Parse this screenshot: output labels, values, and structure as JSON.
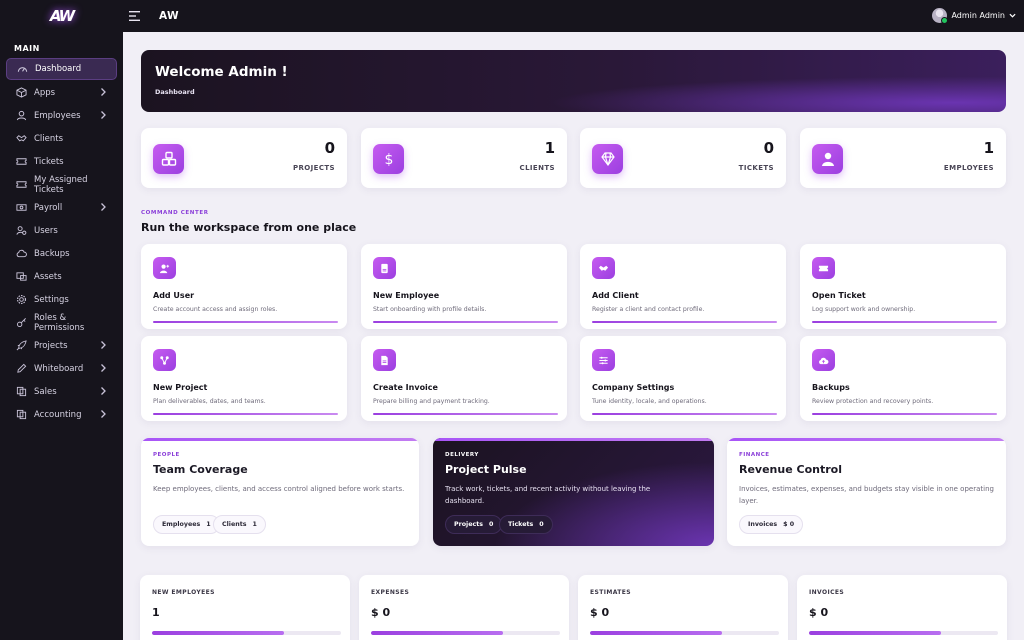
{
  "brand": {
    "logo_text": "AW",
    "title": "AW"
  },
  "user": {
    "name": "Admin Admin"
  },
  "sidebar": {
    "section": "MAIN",
    "items": [
      {
        "label": "Dashboard",
        "icon": "dashboard-icon",
        "active": true,
        "expandable": false
      },
      {
        "label": "Apps",
        "icon": "cube-icon",
        "expandable": true
      },
      {
        "label": "Employees",
        "icon": "user-icon",
        "expandable": true
      },
      {
        "label": "Clients",
        "icon": "handshake-icon",
        "expandable": false
      },
      {
        "label": "Tickets",
        "icon": "ticket-icon",
        "expandable": false
      },
      {
        "label": "My Assigned Tickets",
        "icon": "ticket-icon",
        "expandable": false
      },
      {
        "label": "Payroll",
        "icon": "money-icon",
        "expandable": true
      },
      {
        "label": "Users",
        "icon": "users-gear-icon",
        "expandable": false
      },
      {
        "label": "Backups",
        "icon": "cloud-icon",
        "expandable": false
      },
      {
        "label": "Assets",
        "icon": "assets-icon",
        "expandable": false
      },
      {
        "label": "Settings",
        "icon": "gear-icon",
        "expandable": false
      },
      {
        "label": "Roles & Permissions",
        "icon": "key-icon",
        "expandable": false
      },
      {
        "label": "Projects",
        "icon": "rocket-icon",
        "expandable": true
      },
      {
        "label": "Whiteboard",
        "icon": "pen-icon",
        "expandable": true
      },
      {
        "label": "Sales",
        "icon": "copy-icon",
        "expandable": true
      },
      {
        "label": "Accounting",
        "icon": "copy-icon",
        "expandable": true
      }
    ]
  },
  "welcome": {
    "title": "Welcome Admin !",
    "breadcrumb": "Dashboard"
  },
  "stats": [
    {
      "value": "0",
      "label": "PROJECTS",
      "icon": "cubes-icon"
    },
    {
      "value": "1",
      "label": "CLIENTS",
      "icon": "dollar-icon"
    },
    {
      "value": "0",
      "label": "TICKETS",
      "icon": "diamond-icon"
    },
    {
      "value": "1",
      "label": "EMPLOYEES",
      "icon": "user-icon"
    }
  ],
  "command_center": {
    "kicker": "COMMAND CENTER",
    "title": "Run the workspace from one place",
    "actions": [
      {
        "title": "Add User",
        "desc": "Create account access and assign roles.",
        "icon": "user-plus-icon"
      },
      {
        "title": "New Employee",
        "desc": "Start onboarding with profile details.",
        "icon": "id-badge-icon"
      },
      {
        "title": "Add Client",
        "desc": "Register a client and contact profile.",
        "icon": "handshake-icon"
      },
      {
        "title": "Open Ticket",
        "desc": "Log support work and ownership.",
        "icon": "ticket-icon"
      },
      {
        "title": "New Project",
        "desc": "Plan deliverables, dates, and teams.",
        "icon": "project-diagram-icon"
      },
      {
        "title": "Create Invoice",
        "desc": "Prepare billing and payment tracking.",
        "icon": "invoice-icon"
      },
      {
        "title": "Company Settings",
        "desc": "Tune identity, locale, and operations.",
        "icon": "sliders-icon"
      },
      {
        "title": "Backups",
        "desc": "Review protection and recovery points.",
        "icon": "cloud-upload-icon"
      }
    ]
  },
  "panels": [
    {
      "kicker": "PEOPLE",
      "title": "Team Coverage",
      "desc": "Keep employees, clients, and access control aligned before work starts.",
      "chips": [
        {
          "label": "Employees",
          "count": "1"
        },
        {
          "label": "Clients",
          "count": "1"
        }
      ]
    },
    {
      "kicker": "DELIVERY",
      "title": "Project Pulse",
      "desc": "Track work, tickets, and recent activity without leaving the dashboard.",
      "chips": [
        {
          "label": "Projects",
          "count": "0"
        },
        {
          "label": "Tickets",
          "count": "0"
        }
      ]
    },
    {
      "kicker": "FINANCE",
      "title": "Revenue Control",
      "desc": "Invoices, estimates, expenses, and budgets stay visible in one operating layer.",
      "chips": [
        {
          "label": "Invoices",
          "count": "$ 0"
        }
      ]
    }
  ],
  "metrics": [
    {
      "label": "NEW EMPLOYEES",
      "value": "1",
      "progress": 0.7
    },
    {
      "label": "EXPENSES",
      "value": "$ 0",
      "progress": 0.7
    },
    {
      "label": "ESTIMATES",
      "value": "$ 0",
      "progress": 0.7
    },
    {
      "label": "INVOICES",
      "value": "$ 0",
      "progress": 0.7
    }
  ],
  "colors": {
    "accent": "#a855f7",
    "sidebar_bg": "#16141c",
    "page_bg": "#f1eff6"
  }
}
